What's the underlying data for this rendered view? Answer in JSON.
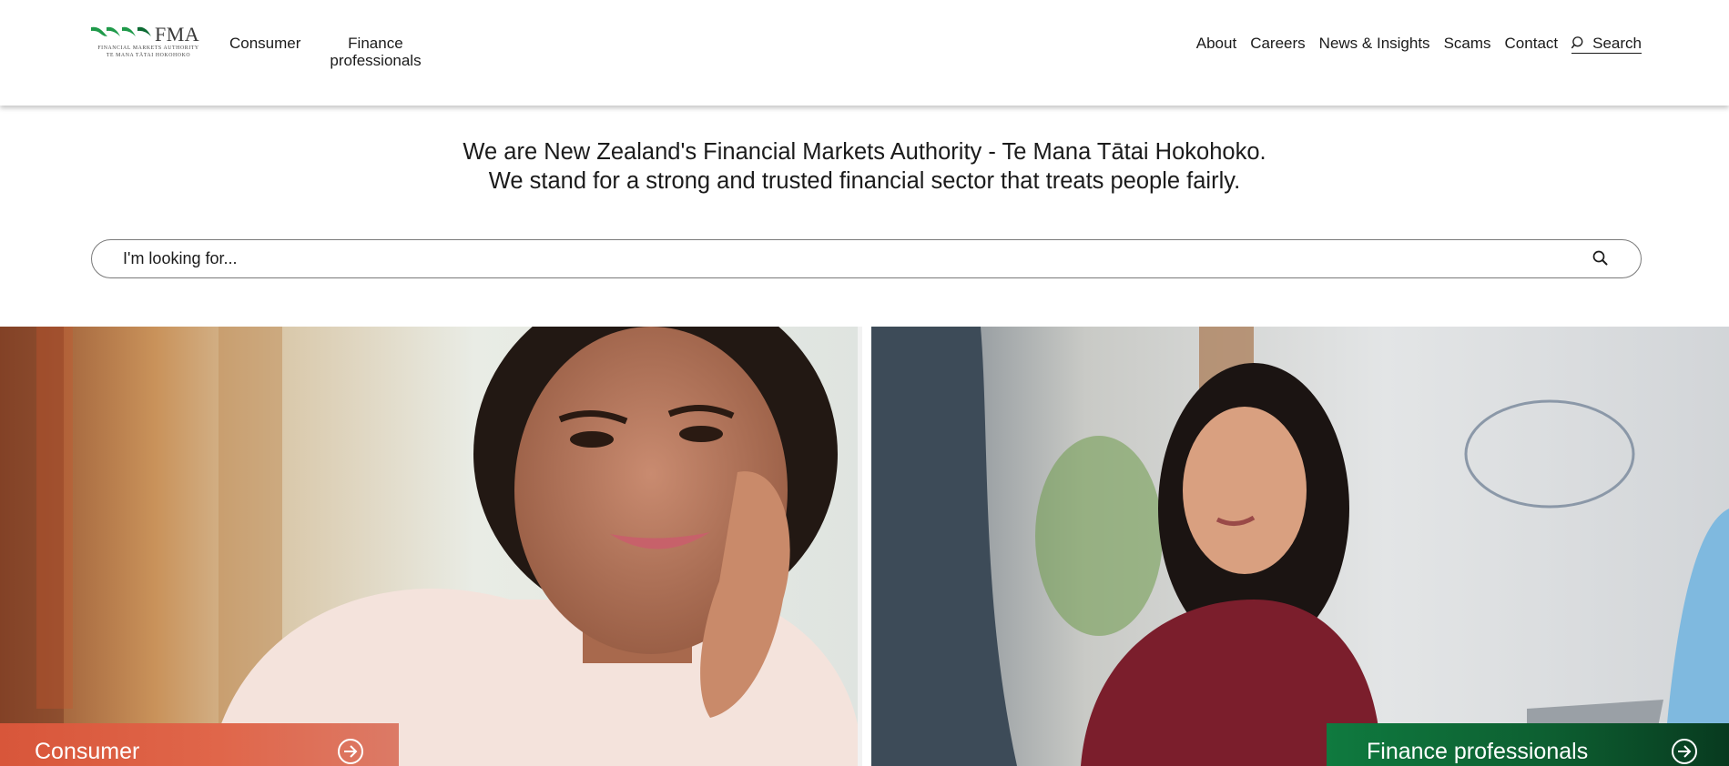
{
  "header": {
    "logo": {
      "name": "FMA",
      "subtitle_line1": "FINANCIAL MARKETS AUTHORITY",
      "subtitle_line2": "TE MANA TĀTAI HOKOHOKO",
      "colors": [
        "#1f9a4a",
        "#0c6b33"
      ]
    },
    "primary_nav": [
      {
        "label": "Consumer"
      },
      {
        "label": "Finance professionals"
      }
    ],
    "utility_nav": [
      {
        "label": "About"
      },
      {
        "label": "Careers"
      },
      {
        "label": "News & Insights"
      },
      {
        "label": "Scams"
      },
      {
        "label": "Contact"
      }
    ],
    "search": {
      "label": "Search",
      "icon": "search-icon"
    }
  },
  "intro": {
    "line1": "We are New Zealand's Financial Markets Authority - Te Mana Tātai Hokohoko.",
    "line2": "We stand for a strong and trusted financial sector that treats people fairly."
  },
  "search_bar": {
    "placeholder": "I'm looking for...",
    "icon": "search-icon"
  },
  "cards": [
    {
      "label": "Consumer",
      "icon": "arrow-circle-right-icon",
      "color": "#d8563a"
    },
    {
      "label": "Finance professionals",
      "icon": "arrow-circle-right-icon",
      "color": "#0f7a3f"
    }
  ]
}
